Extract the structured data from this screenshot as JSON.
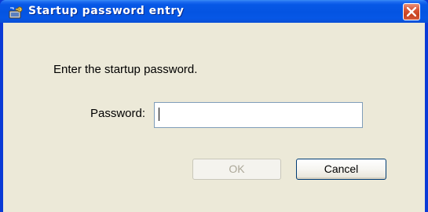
{
  "window": {
    "title": "Startup password entry",
    "title_icon": "computer-key-icon",
    "close_icon": "close-icon"
  },
  "dialog": {
    "prompt": "Enter the startup password.",
    "password_label": "Password:",
    "password_value": "",
    "ok_label": "OK",
    "ok_enabled": false,
    "cancel_label": "Cancel"
  },
  "colors": {
    "titlebar": "#0454e2",
    "client": "#ece9d8",
    "close_button": "#c8421f",
    "input_border": "#7f9db9"
  }
}
